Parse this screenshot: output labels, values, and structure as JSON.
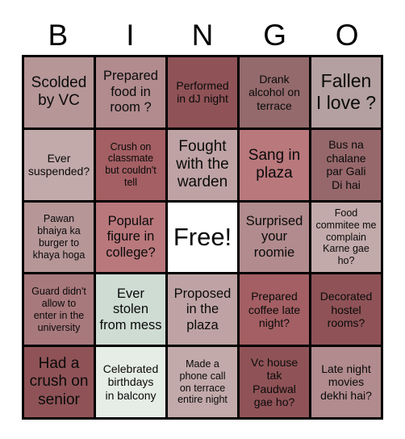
{
  "card": {
    "title": "BINGO",
    "header_letters": [
      "B",
      "I",
      "N",
      "G",
      "O"
    ],
    "free_space_label": "Free!",
    "colors": {
      "border": "#000000",
      "text": "#0a0a0a",
      "background": "#ffffff",
      "rose_light": "#b69697",
      "rose_pale": "#b4a0a0",
      "rose_mid": "#a8797c",
      "rose_dark": "#8f5357",
      "rose_deep": "#96686b",
      "mauve": "#bfa3a4",
      "mint": "#cedcd4",
      "mint_pale": "#e6ece6",
      "free_white": "#ffffff"
    },
    "columns": {
      "B": [
        {
          "text": "Scolded\nby VC",
          "color": "#b69697",
          "size": "fs-lg"
        },
        {
          "text": "Ever\nsuspended?",
          "color": "#c3aaaa",
          "size": "fs-sm"
        },
        {
          "text": "Pawan\nbhaiya ka\nburger to\nkhaya hoga",
          "color": "#b69697",
          "size": "fs-xs"
        },
        {
          "text": "Guard didn't\nallow to\nenter in the\nuniversity",
          "color": "#a8797c",
          "size": "fs-xs"
        },
        {
          "text": "Had a\ncrush on\nsenior",
          "color": "#8f5357",
          "size": "fs-lg"
        }
      ],
      "I": [
        {
          "text": "Prepared\nfood in\nroom ?",
          "color": "#b18b8d",
          "size": "fs-md"
        },
        {
          "text": "Crush on\nclassmate\nbut couldn't\ntell",
          "color": "#a35f63",
          "size": "fs-xs"
        },
        {
          "text": "Popular\nfigure in\ncollege?",
          "color": "#b9787c",
          "size": "fs-md"
        },
        {
          "text": "Ever\nstolen\nfrom mess",
          "color": "#cedcd4",
          "size": "fs-md"
        },
        {
          "text": "Celebrated\nbirthdays\nin balcony",
          "color": "#e6ece6",
          "size": "fs-sm"
        }
      ],
      "N": [
        {
          "text": "Performed\nin dJ night",
          "color": "#8f5357",
          "size": "fs-sm"
        },
        {
          "text": "Fought\nwith the\nwarden",
          "color": "#bfa3a4",
          "size": "fs-lg"
        },
        {
          "text": "Free!",
          "color": "#ffffff",
          "size": "free-cell"
        },
        {
          "text": "Proposed\nin the\nplaza",
          "color": "#bfa3a4",
          "size": "fs-md"
        },
        {
          "text": "Made a\nphone call\non terrace\nentire night",
          "color": "#c3aaaa",
          "size": "fs-xs"
        }
      ],
      "G": [
        {
          "text": "Drank\nalcohol on\nterrace",
          "color": "#946a6c",
          "size": "fs-sm"
        },
        {
          "text": "Sang in\nplaza",
          "color": "#b9787c",
          "size": "fs-lg"
        },
        {
          "text": "Surprised\nyour\nroomie",
          "color": "#b18b8d",
          "size": "fs-md"
        },
        {
          "text": "Prepared\ncoffee late\nnight?",
          "color": "#a35f63",
          "size": "fs-sm"
        },
        {
          "text": "Vc house\ntak\nPaudwal\ngae ho?",
          "color": "#8f5357",
          "size": "fs-sm"
        }
      ],
      "O": [
        {
          "text": "Fallen\nI love ?",
          "color": "#b4a0a0",
          "size": "fs-xl"
        },
        {
          "text": "Bus na\nchalane\npar Gali\nDi hai",
          "color": "#96686b",
          "size": "fs-sm"
        },
        {
          "text": "Food\ncommitee me\ncomplain\nKarne gae\nho?",
          "color": "#c3aaaa",
          "size": "fs-xs"
        },
        {
          "text": "Decorated\nhostel\nrooms?",
          "color": "#8f5357",
          "size": "fs-sm"
        },
        {
          "text": "Late night\nmovies\ndekhi hai?",
          "color": "#b18b8d",
          "size": "fs-sm"
        }
      ]
    }
  }
}
